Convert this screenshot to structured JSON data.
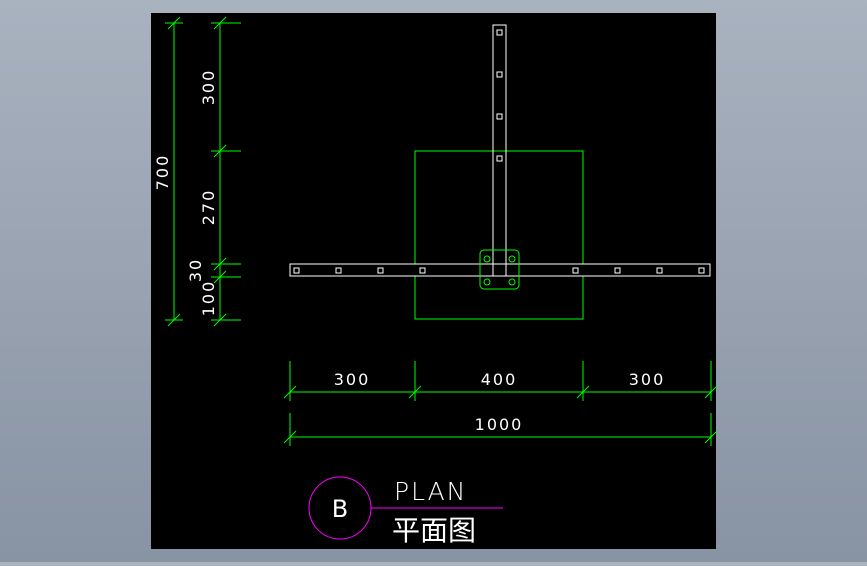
{
  "colors": {
    "frame_bg": "#b0b8c4",
    "canvas": "#000000",
    "dimension": "#00ff00",
    "object": "#ffffff",
    "footprint": "#00ff00",
    "label": "#ffffff",
    "callout": "#ff00ff"
  },
  "dimensions": {
    "vertical_total": "700",
    "vertical_segments": [
      "300",
      "270",
      "30",
      "100"
    ],
    "horizontal_segments": [
      "300",
      "400",
      "300"
    ],
    "horizontal_total": "1000"
  },
  "title_block": {
    "section_mark": "B",
    "title_en": "PLAN",
    "title_zh": "平面图"
  }
}
